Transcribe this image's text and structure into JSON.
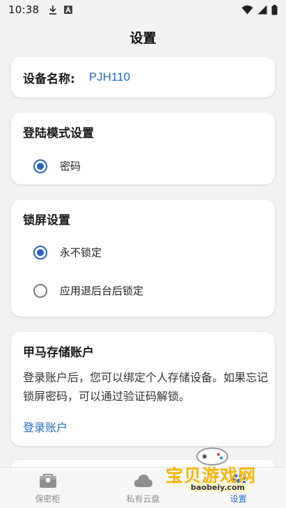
{
  "status_bar": {
    "time": "10:38",
    "icons_left": [
      "download-icon",
      "a-badge-icon"
    ],
    "icons_right": [
      "wifi-icon",
      "signal-icon",
      "battery-icon"
    ]
  },
  "header": {
    "title": "设置"
  },
  "device": {
    "label": "设备名称:",
    "value": "PJH110"
  },
  "login_mode": {
    "title": "登陆模式设置",
    "options": [
      {
        "label": "密码",
        "checked": true
      }
    ]
  },
  "lock_screen": {
    "title": "锁屏设置",
    "options": [
      {
        "label": "永不锁定",
        "checked": true
      },
      {
        "label": "应用退后台后锁定",
        "checked": false
      }
    ]
  },
  "account": {
    "title": "甲马存储账户",
    "description": "登录账户后，您可以绑定个人存储设备。如果忘记锁屏密码，可以通过验证码解锁。",
    "link": "登录账户"
  },
  "bottom_nav": {
    "items": [
      {
        "label": "保密柜",
        "icon": "safe-box-icon",
        "active": false
      },
      {
        "label": "私有云盘",
        "icon": "cloud-icon",
        "active": false
      },
      {
        "label": "设置",
        "icon": "settings-icon",
        "active": true
      }
    ]
  },
  "watermark": {
    "text": "宝贝游戏网",
    "url": "baobeiy.com"
  },
  "colors": {
    "accent": "#2a68c9",
    "background": "#f2f2f4",
    "card": "#ffffff"
  }
}
